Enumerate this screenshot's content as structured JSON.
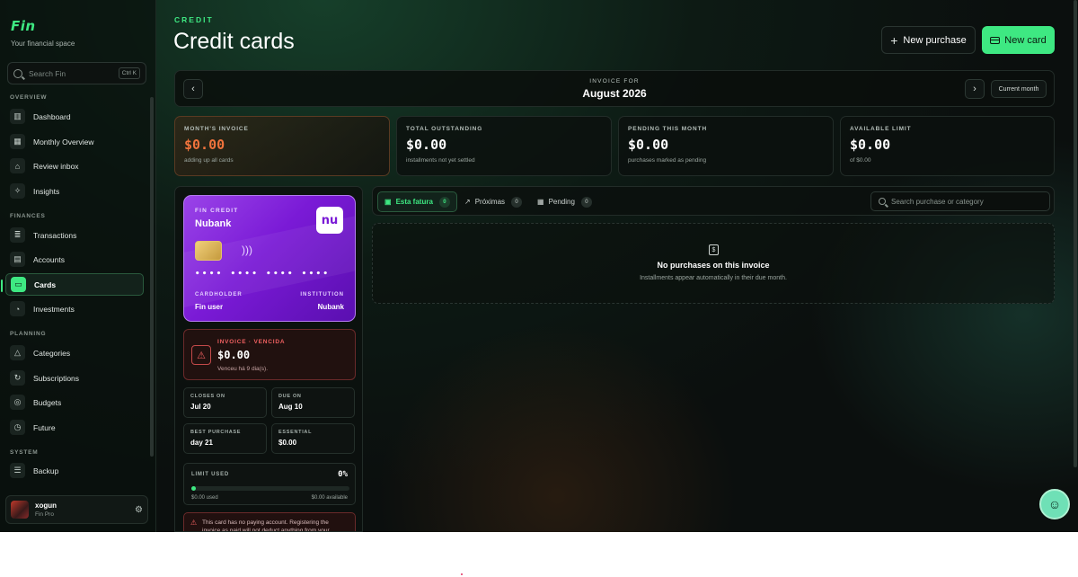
{
  "app": {
    "logo": "Fin",
    "tagline": "Your financial space"
  },
  "search": {
    "placeholder": "Search Fin",
    "shortcut": "Ctrl K"
  },
  "sidebar": {
    "sections": {
      "overview": "OVERVIEW",
      "finances": "FINANCES",
      "planning": "PLANNING",
      "system": "SYSTEM"
    },
    "items": {
      "dashboard": "Dashboard",
      "monthly": "Monthly Overview",
      "review": "Review inbox",
      "insights": "Insights",
      "transactions": "Transactions",
      "accounts": "Accounts",
      "cards": "Cards",
      "investments": "Investments",
      "categories": "Categories",
      "subscriptions": "Subscriptions",
      "budgets": "Budgets",
      "future": "Future",
      "backup": "Backup"
    },
    "active": "cards"
  },
  "user": {
    "name": "xogun",
    "plan": "Fin Pro"
  },
  "header": {
    "eyebrow": "CREDIT",
    "title": "Credit cards",
    "new_purchase": "New purchase",
    "new_card": "New card"
  },
  "invoice": {
    "label": "INVOICE FOR",
    "month": "August 2026",
    "current_month": "Current month"
  },
  "stats": [
    {
      "label": "MONTH'S INVOICE",
      "value": "$0.00",
      "sub": "adding up all cards"
    },
    {
      "label": "TOTAL OUTSTANDING",
      "value": "$0.00",
      "sub": "installments not yet settled"
    },
    {
      "label": "PENDING THIS MONTH",
      "value": "$0.00",
      "sub": "purchases marked as pending"
    },
    {
      "label": "AVAILABLE LIMIT",
      "value": "$0.00",
      "sub": "of $0.00"
    }
  ],
  "card": {
    "eyebrow": "FIN CREDIT",
    "bank": "Nubank",
    "logo": "nu",
    "number": "•••• •••• •••• ••••",
    "cardholder_label": "CARDHOLDER",
    "cardholder": "Fin user",
    "institution_label": "INSTITUTION",
    "institution": "Nubank"
  },
  "invoice_status": {
    "title": "INVOICE · VENCIDA",
    "amount": "$0.00",
    "sub": "Venceu há 9 dia(s)."
  },
  "details": {
    "closes_label": "CLOSES ON",
    "closes": "Jul 20",
    "due_label": "DUE ON",
    "due": "Aug 10",
    "best_label": "BEST PURCHASE",
    "best": "day 21",
    "essential_label": "ESSENTIAL",
    "essential": "$0.00"
  },
  "limit": {
    "label": "LIMIT USED",
    "percent": "0%",
    "fraction": 0.0,
    "used": "$0.00 used",
    "available": "$0.00 available"
  },
  "warning": {
    "text": "This card has no paying account. Registering the invoice as paid will not deduct anything from your"
  },
  "tabs": [
    {
      "label": "Esta fatura",
      "count": "0"
    },
    {
      "label": "Próximas",
      "count": "0"
    },
    {
      "label": "Pending",
      "count": "0"
    }
  ],
  "purchase_search": {
    "placeholder": "Search purchase or category"
  },
  "empty": {
    "title": "No purchases on this invoice",
    "sub": "Installments appear automatically in their due month."
  },
  "colors": {
    "accent": "#3ee882",
    "danger": "#f06060",
    "card_purple": "#7a1ad6"
  }
}
